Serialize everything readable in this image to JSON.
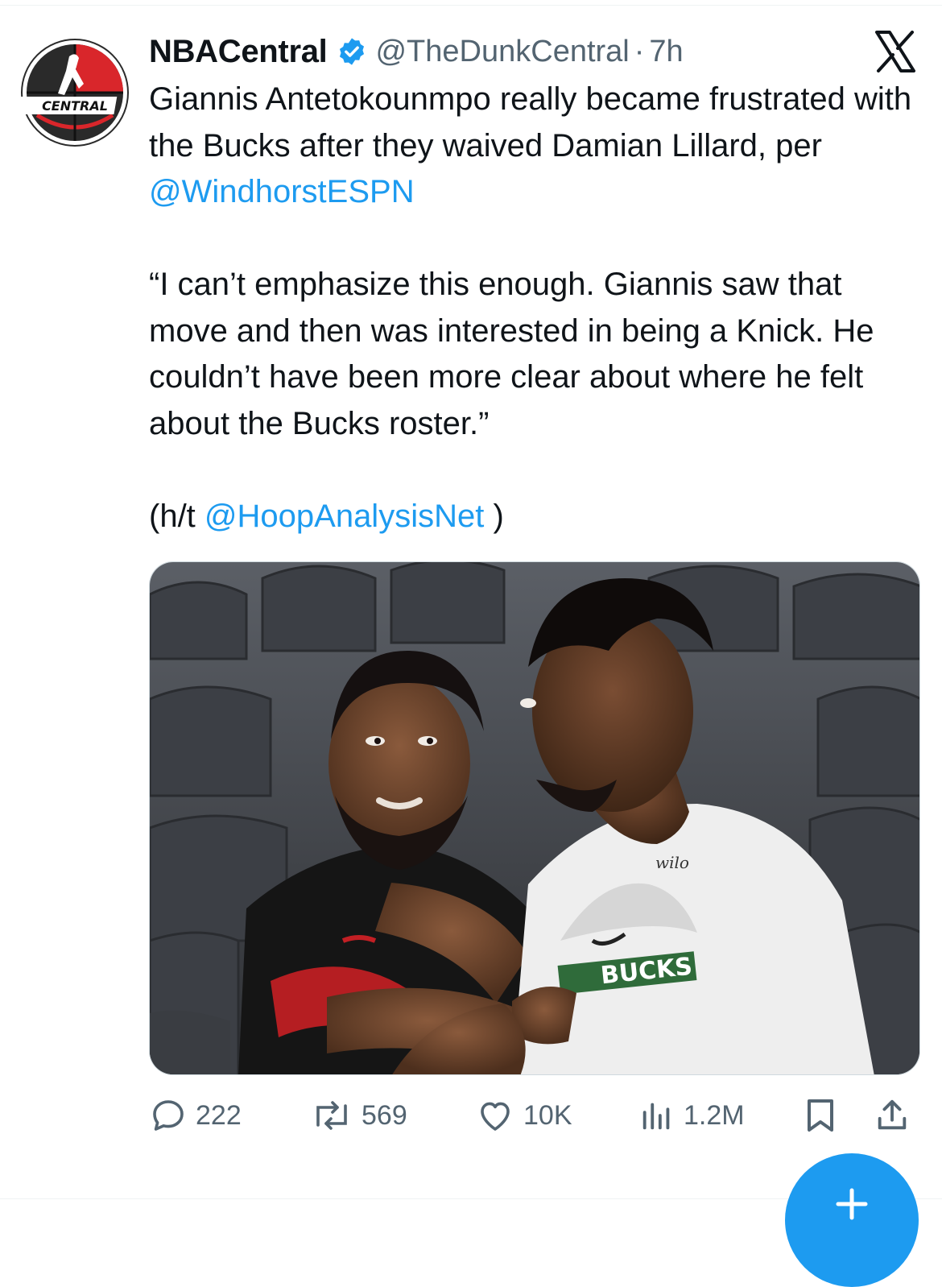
{
  "tweet": {
    "display_name": "NBACentral",
    "handle": "@TheDunkCentral",
    "separator": "·",
    "time": "7h",
    "avatar_text": "CENTRAL",
    "text": {
      "line1_a": "Giannis Antetokounmpo really became frustrated with the Bucks after they waived Damian Lillard, per ",
      "line1_mention": "@WindhorstESPN",
      "quote": "“I can’t emphasize this enough. Giannis saw that move and then was interested in being a Knick. He couldn’t have been more clear about where he felt about the Bucks roster.”",
      "ht_prefix": "(h/t ",
      "ht_mention": "@HoopAnalysisNet",
      "ht_suffix": " )"
    },
    "image_texts": {
      "shirt_brand": "BUCKS",
      "shirt_logo": "wilo"
    }
  },
  "actions": {
    "replies": "222",
    "reposts": "569",
    "likes": "10K",
    "views": "1.2M"
  },
  "icons": {
    "verified": "verified-badge-icon",
    "close": "x-logo-icon",
    "reply": "reply-bubble-icon",
    "repost": "repost-icon",
    "like": "heart-icon",
    "views": "views-chart-icon",
    "bookmark": "bookmark-icon",
    "share": "share-icon",
    "compose": "compose-plus-icon"
  },
  "colors": {
    "link": "#1d9bf0",
    "muted": "#536471",
    "text": "#0f1419",
    "accent": "#1d9bf0"
  }
}
